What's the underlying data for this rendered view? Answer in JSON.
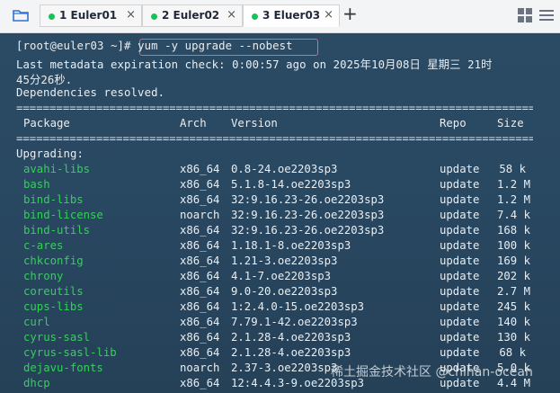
{
  "tabs": [
    {
      "label": "1 Euler01",
      "active": false
    },
    {
      "label": "2 Euler02",
      "active": false
    },
    {
      "label": "3 Eluer03",
      "active": true
    }
  ],
  "tab_close_glyph": "×",
  "new_tab_glyph": "+",
  "icons": {
    "folder": "folder-icon",
    "grid": "grid-view-icon",
    "menu": "menu-icon"
  },
  "colors": {
    "terminal_bg": "#2b4a63",
    "package_green": "#34d058",
    "command_highlight": "#ff5b73",
    "tab_status_dot": "#18c15a"
  },
  "terminal": {
    "prompt": "[root@euler03 ~]#",
    "command": "yum -y upgrade --nobest",
    "metadata_line_1": "Last metadata expiration check: 0:00:57 ago on 2025年10月08日 星期三 21时",
    "metadata_line_2": "45分26秒.",
    "dependencies": "Dependencies resolved.",
    "separator": "================================================================================",
    "headers": {
      "package": "Package",
      "arch": "Arch",
      "version": "Version",
      "repo": "Repo",
      "size": "Size"
    },
    "section": "Upgrading:",
    "packages": [
      {
        "name": "avahi-libs",
        "arch": "x86_64",
        "version": "0.8-24.oe2203sp3",
        "repo": "update",
        "size": "58 k"
      },
      {
        "name": "bash",
        "arch": "x86_64",
        "version": "5.1.8-14.oe2203sp3",
        "repo": "update",
        "size": "1.2 M"
      },
      {
        "name": "bind-libs",
        "arch": "x86_64",
        "version": "32:9.16.23-26.oe2203sp3",
        "repo": "update",
        "size": "1.2 M"
      },
      {
        "name": "bind-license",
        "arch": "noarch",
        "version": "32:9.16.23-26.oe2203sp3",
        "repo": "update",
        "size": "7.4 k"
      },
      {
        "name": "bind-utils",
        "arch": "x86_64",
        "version": "32:9.16.23-26.oe2203sp3",
        "repo": "update",
        "size": "168 k"
      },
      {
        "name": "c-ares",
        "arch": "x86_64",
        "version": "1.18.1-8.oe2203sp3",
        "repo": "update",
        "size": "100 k"
      },
      {
        "name": "chkconfig",
        "arch": "x86_64",
        "version": "1.21-3.oe2203sp3",
        "repo": "update",
        "size": "169 k"
      },
      {
        "name": "chrony",
        "arch": "x86_64",
        "version": "4.1-7.oe2203sp3",
        "repo": "update",
        "size": "202 k"
      },
      {
        "name": "coreutils",
        "arch": "x86_64",
        "version": "9.0-20.oe2203sp3",
        "repo": "update",
        "size": "2.7 M"
      },
      {
        "name": "cups-libs",
        "arch": "x86_64",
        "version": "1:2.4.0-15.oe2203sp3",
        "repo": "update",
        "size": "245 k"
      },
      {
        "name": "curl",
        "arch": "x86_64",
        "version": "7.79.1-42.oe2203sp3",
        "repo": "update",
        "size": "140 k"
      },
      {
        "name": "cyrus-sasl",
        "arch": "x86_64",
        "version": "2.1.28-4.oe2203sp3",
        "repo": "update",
        "size": "130 k"
      },
      {
        "name": "cyrus-sasl-lib",
        "arch": "x86_64",
        "version": "2.1.28-4.oe2203sp3",
        "repo": "update",
        "size": "68 k"
      },
      {
        "name": "dejavu-fonts",
        "arch": "noarch",
        "version": "2.37-3.oe2203sp3",
        "repo": "update",
        "size": "5.0 k"
      },
      {
        "name": "dhcp",
        "arch": "x86_64",
        "version": "12:4.4.3-9.oe2203sp3",
        "repo": "update",
        "size": "4.4 M"
      }
    ]
  },
  "watermark": "稀土掘金技术社区 @chihan-ocean"
}
